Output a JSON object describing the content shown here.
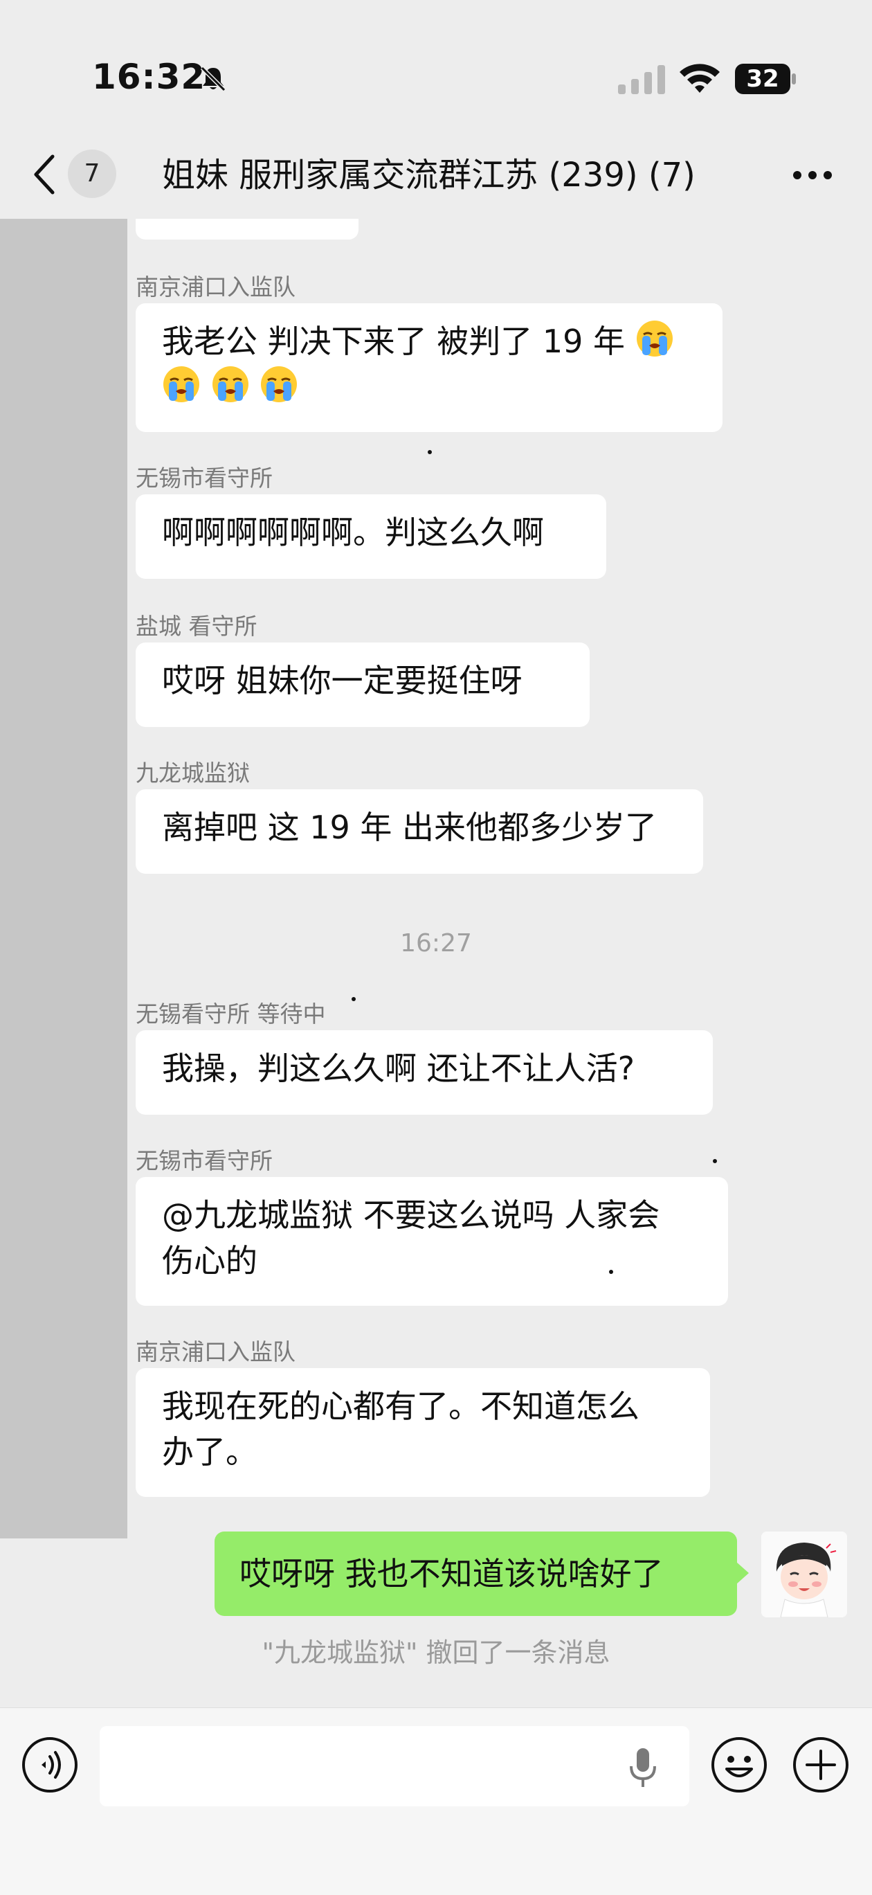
{
  "status_bar": {
    "time": "16:32",
    "battery": "32"
  },
  "nav": {
    "unread_count": "7",
    "title": "姐妹 服刑家属交流群江苏 (239) (7)"
  },
  "messages": [
    {
      "sender": "南京浦口入监队",
      "text_line1": "我老公 判决下来了  被判了 19 年"
    },
    {
      "sender": "无锡市看守所",
      "text": "啊啊啊啊啊啊。判这么久啊"
    },
    {
      "sender": "盐城 看守所",
      "text": "哎呀 姐妹你一定要挺住呀"
    },
    {
      "sender": "九龙城监狱",
      "text": "离掉吧 这 19 年 出来他都多少岁了"
    },
    {
      "sender": "无锡看守所 等待中",
      "text": "我操，判这么久啊  还让不让人活?"
    },
    {
      "sender": "无锡市看守所",
      "text_line1": "@九龙城监狱 不要这么说吗 人家会",
      "text_line2": "伤心的"
    },
    {
      "sender": "南京浦口入监队",
      "text_line1": "我现在死的心都有了。不知道怎么",
      "text_line2": "办了。"
    }
  ],
  "time_separator": "16:27",
  "my_message": "哎呀呀 我也不知道该说啥好了",
  "recall_notice": "\"九龙城监狱\" 撤回了一条消息",
  "colors": {
    "my_bubble": "#95ec69",
    "chat_background": "#ededed",
    "bubble": "#ffffff"
  },
  "icons": [
    "bell-off-icon",
    "signal-icon",
    "wifi-icon",
    "battery-icon",
    "back-icon",
    "more-icon",
    "crying-emoji",
    "voice-icon",
    "mic-icon",
    "emoji-icon",
    "plus-icon"
  ]
}
